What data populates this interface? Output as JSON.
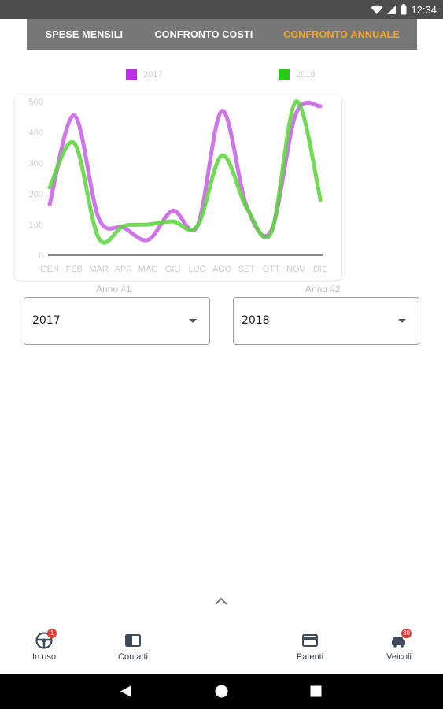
{
  "status_bar": {
    "time": "12:34",
    "icons": [
      "wifi-icon",
      "signal-icon",
      "battery-icon"
    ],
    "background": "#4d4d4d"
  },
  "tabs": [
    {
      "label": "SPESE MENSILI",
      "active": false
    },
    {
      "label": "CONFRONTO COSTI",
      "active": false
    },
    {
      "label": "CONFRONTO ANNUALE",
      "active": true
    }
  ],
  "colors": {
    "tab_bar": "#777777",
    "active_tab": "#f5a623",
    "series_2017": "#c763e6",
    "series_2018": "#5fd63f",
    "swatch_2017": "#b833e0",
    "swatch_2018": "#22cc11"
  },
  "chart_data": {
    "type": "line",
    "categories": [
      "GEN",
      "FEB",
      "MAR",
      "APR",
      "MAG",
      "GIU",
      "LUG",
      "AGO",
      "SET",
      "OTT",
      "NOV",
      "DIC"
    ],
    "series": [
      {
        "name": "2017",
        "values": [
          165,
          455,
          120,
          90,
          50,
          145,
          95,
          470,
          160,
          80,
          460,
          485
        ]
      },
      {
        "name": "2018",
        "values": [
          220,
          365,
          55,
          95,
          100,
          110,
          95,
          325,
          155,
          75,
          500,
          180
        ]
      }
    ],
    "y_ticks": [
      0,
      100,
      200,
      300,
      400,
      500
    ],
    "ylim": [
      0,
      500
    ],
    "smooth": true,
    "grid": false,
    "legend": "top"
  },
  "selectors": {
    "anno1": {
      "label": "Anno #1",
      "value": "2017"
    },
    "anno2": {
      "label": "Anno #2",
      "value": "2018"
    }
  },
  "bottom_nav": [
    {
      "label": "In uso",
      "icon": "steering-wheel-icon",
      "badge": "1"
    },
    {
      "label": "Contatti",
      "icon": "contacts-icon",
      "badge": ""
    },
    {
      "label": "Patenti",
      "icon": "card-icon",
      "badge": ""
    },
    {
      "label": "Veicoli",
      "icon": "car-icon",
      "badge": "30"
    }
  ]
}
